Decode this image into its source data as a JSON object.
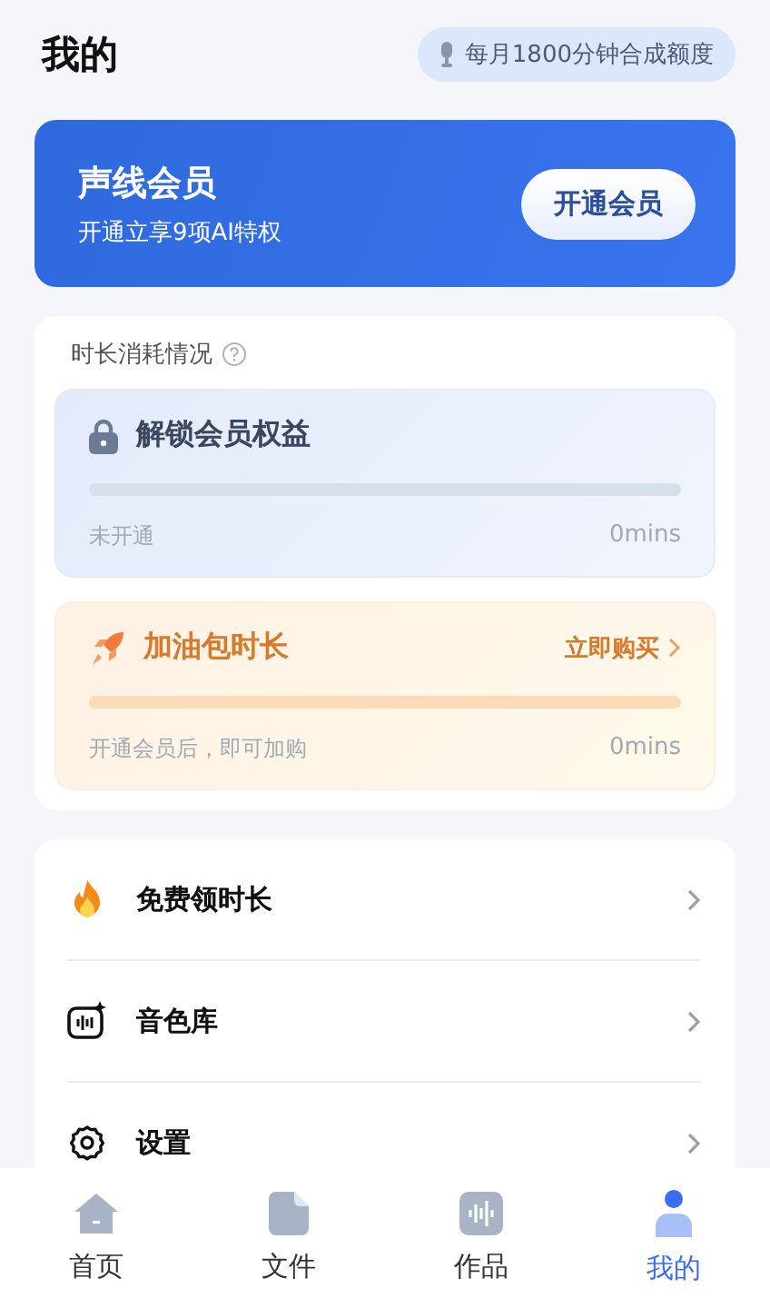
{
  "header": {
    "title": "我的",
    "quota_badge": "每月1800分钟合成额度"
  },
  "membership_banner": {
    "title": "声线会员",
    "subtitle": "开通立享9项AI特权",
    "button": "开通会员"
  },
  "usage": {
    "title": "时长消耗情况",
    "cards": [
      {
        "kind": "member",
        "title": "解锁会员权益",
        "level": 0,
        "status": "未开通",
        "amount": "0mins"
      },
      {
        "kind": "addon",
        "title": "加油包时长",
        "action": "立即购买",
        "level": 0,
        "status": "开通会员后，即可加购",
        "amount": "0mins"
      }
    ]
  },
  "menu": [
    {
      "kind": "fire",
      "label": "免费领时长"
    },
    {
      "kind": "voice",
      "label": "音色库"
    },
    {
      "kind": "settings",
      "label": "设置"
    }
  ],
  "tab_bar": [
    {
      "kind": "home",
      "label": "首页",
      "selected": false
    },
    {
      "kind": "file",
      "label": "文件",
      "selected": false
    },
    {
      "kind": "works",
      "label": "作品",
      "selected": false
    },
    {
      "kind": "me",
      "label": "我的",
      "selected": true
    }
  ]
}
